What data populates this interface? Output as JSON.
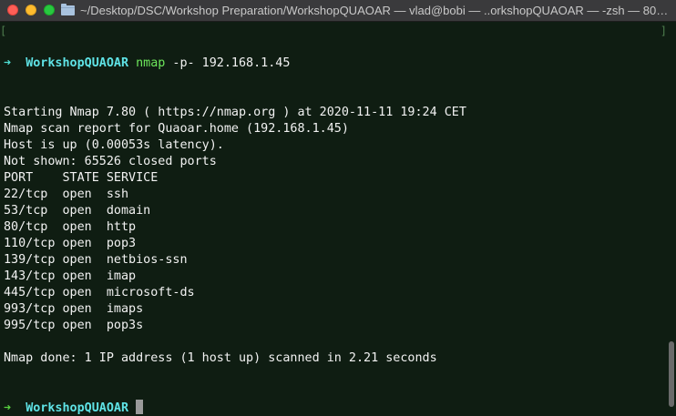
{
  "window": {
    "title": "~/Desktop/DSC/Workshop Preparation/WorkshopQUAOAR — vlad@bobi — ..orkshopQUAOAR — -zsh — 80…",
    "bracket_left": "[",
    "bracket_right": "]"
  },
  "prompt": {
    "arrow": "➜",
    "directory": "WorkshopQUAOAR"
  },
  "command": {
    "name": "nmap",
    "args": " -p- 192.168.1.45"
  },
  "output": [
    "Starting Nmap 7.80 ( https://nmap.org ) at 2020-11-11 19:24 CET",
    "Nmap scan report for Quaoar.home (192.168.1.45)",
    "Host is up (0.00053s latency).",
    "Not shown: 65526 closed ports",
    "PORT    STATE SERVICE",
    "22/tcp  open  ssh",
    "53/tcp  open  domain",
    "80/tcp  open  http",
    "110/tcp open  pop3",
    "139/tcp open  netbios-ssn",
    "143/tcp open  imap",
    "445/tcp open  microsoft-ds",
    "993/tcp open  imaps",
    "995/tcp open  pop3s",
    "",
    "Nmap done: 1 IP address (1 host up) scanned in 2.21 seconds"
  ],
  "colors": {
    "background": "#0f1d12",
    "prompt_directory": "#5fe3e6",
    "command": "#6ee85c",
    "text": "#f2f2f2"
  },
  "icons": {
    "traffic_lights": [
      "close-icon",
      "minimize-icon",
      "maximize-icon"
    ],
    "title_icon": "folder-icon"
  }
}
